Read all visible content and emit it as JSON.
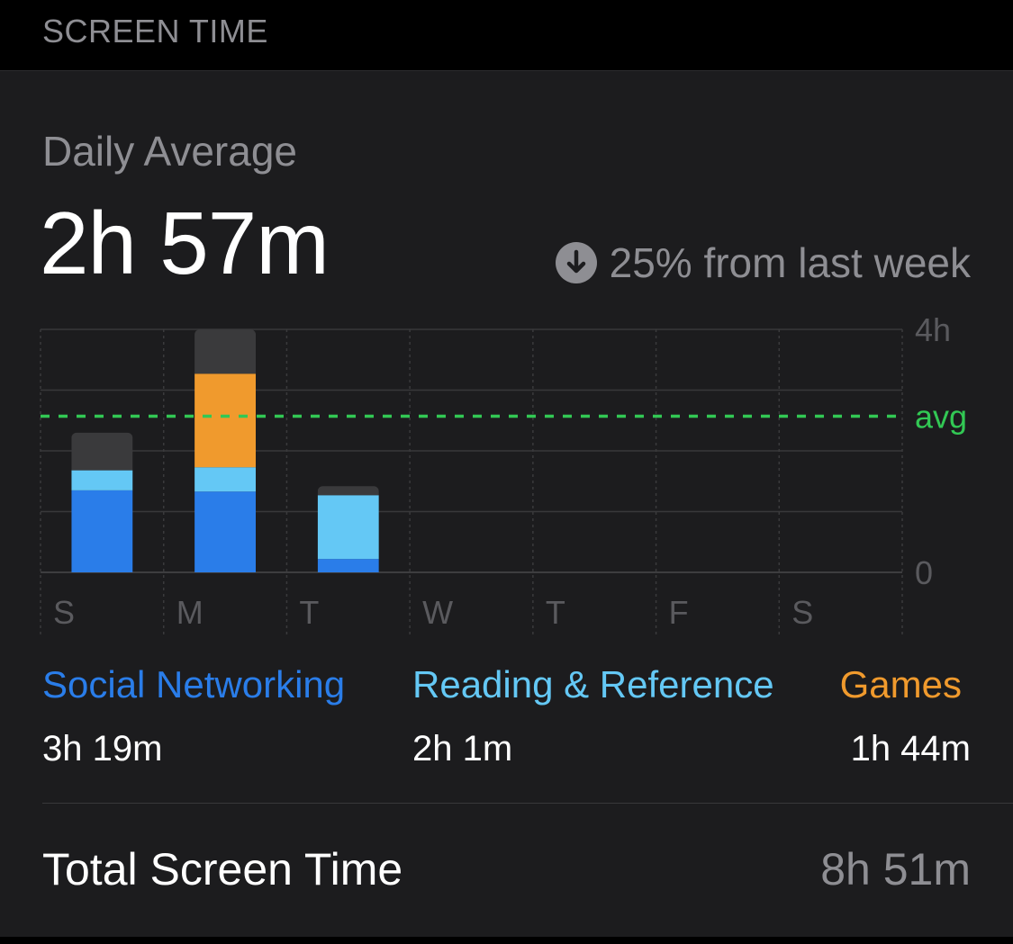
{
  "section_header": "SCREEN TIME",
  "daily_average": {
    "label": "Daily Average",
    "value": "2h 57m"
  },
  "change": {
    "text": "25% from last week",
    "direction": "down",
    "icon": "arrow-down-circle-icon"
  },
  "colors": {
    "social": "#2a7de9",
    "reading": "#64c8f5",
    "games": "#f09a2d",
    "other": "#3a3a3c",
    "avg_line": "#32c854",
    "background": "#1c1c1e"
  },
  "chart_data": {
    "type": "bar",
    "stacked": true,
    "categories": [
      "S",
      "M",
      "T",
      "W",
      "T",
      "F",
      "S"
    ],
    "y_ticks": [
      "4h",
      "0"
    ],
    "ylim_hours": [
      0,
      4
    ],
    "avg_label": "avg",
    "avg_hours": 2.57,
    "grid": true,
    "series": [
      {
        "name": "Social Networking",
        "color": "#2a7de9",
        "values": [
          1.35,
          1.33,
          0.22,
          0,
          0,
          0,
          0
        ]
      },
      {
        "name": "Reading & Reference",
        "color": "#64c8f5",
        "values": [
          0.33,
          0.4,
          1.05,
          0,
          0,
          0,
          0
        ]
      },
      {
        "name": "Games",
        "color": "#f09a2d",
        "values": [
          0,
          1.54,
          0,
          0,
          0,
          0,
          0
        ]
      },
      {
        "color": "#3a3a3c",
        "values": [
          0.62,
          0.73,
          0.15,
          0,
          0,
          0,
          0
        ]
      }
    ]
  },
  "categories_summary": [
    {
      "label": "Social Networking",
      "value": "3h 19m",
      "color": "#2a7de9"
    },
    {
      "label": "Reading & Reference",
      "value": "2h 1m",
      "color": "#64c8f5"
    },
    {
      "label": "Games",
      "value": "1h 44m",
      "color": "#f09a2d"
    }
  ],
  "total": {
    "label": "Total Screen Time",
    "value": "8h 51m"
  }
}
